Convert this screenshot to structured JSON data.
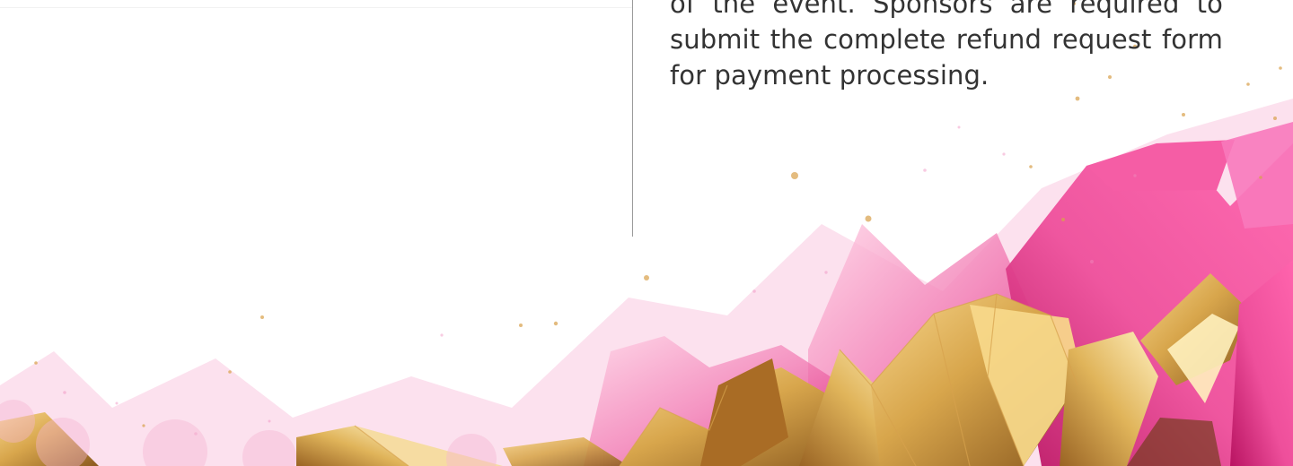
{
  "refund_policy": {
    "text": "of the event. Sponsors are required to submit the complete refund request form for payment processing."
  },
  "colors": {
    "pink": "#e83f8e",
    "light_pink": "#f6a5c6",
    "gold": "#d8a64c",
    "dark_gold": "#8b5a1f",
    "text": "#333333",
    "divider": "#9a9a9a"
  },
  "decorative_art": {
    "description_icon": "pink-and-gold-crystal-mountains"
  }
}
